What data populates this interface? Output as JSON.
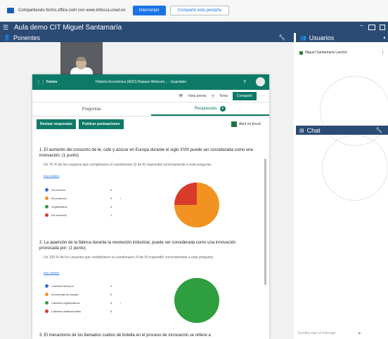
{
  "share_bar": {
    "text": "Compartiendo forms.office.com con www.infocca.uned.es",
    "stop_label": "Interrumpir",
    "share_label": "Compartir esta pestaña"
  },
  "app": {
    "title": "Aula demo CIT Miguel Santamaría"
  },
  "panels": {
    "ponentes": "Ponentes",
    "usuarios": "Usuarios",
    "chat": "Chat"
  },
  "users": [
    {
      "name": "Miguel Santamaría Lancho"
    }
  ],
  "chat_input_placeholder": "Escribe aquí el mensaje",
  "forms": {
    "brand": "Forms",
    "doc_title": "Historia Económica (ADO) Repaso Webcom... - Guardado",
    "toolbar": {
      "preview": "Vista previa",
      "theme": "Tema",
      "share": "Compartir",
      "more": "···"
    },
    "tabs": {
      "questions": "Preguntas",
      "responses": "Respuestas",
      "responses_count": "4"
    },
    "actions": {
      "review": "Revisar respuestas",
      "publish": "Publicar puntuaciones",
      "excel": "Abrir en Excel"
    },
    "questions": [
      {
        "title": "1. El aumento del consumo de té, café y azúcar en Europa durante el siglo XVIII puede ser considerada como una innovación: (1 punto)",
        "summary": "Un 75 % de los usuarios que completaron el cuestionario (3 de 4) respondió correctamente a esta pregunta.",
        "details": "Más detalles",
        "options": [
          {
            "label": "De proceso",
            "count": "0",
            "color": "#2e6fd1",
            "correct": false
          },
          {
            "label": "De producto",
            "count": "3",
            "color": "#f29321",
            "correct": true
          },
          {
            "label": "Organizativa",
            "count": "0",
            "color": "#2e9e3e",
            "correct": false
          },
          {
            "label": "De mercado",
            "count": "1",
            "color": "#d93b2b",
            "correct": false
          }
        ]
      },
      {
        "title": "2. La aparición de la fábrica durante la revolución industrial, puede ser considerada como una innovación provocada por: (1 punto)",
        "summary": "Un 100 % de los usuarios que completaron el cuestionario (4 de 4) respondió correctamente a esta pregunta.",
        "details": "Más detalles",
        "options": [
          {
            "label": "Cambios técnicos",
            "count": "0",
            "color": "#2e6fd1",
            "correct": false
          },
          {
            "label": "Economías de escala",
            "count": "0",
            "color": "#f29321",
            "correct": false
          },
          {
            "label": "Cambios organizativos",
            "count": "4",
            "color": "#2e9e3e",
            "correct": true
          },
          {
            "label": "Cambios institucionales",
            "count": "0",
            "color": "#d93b2b",
            "correct": false
          }
        ]
      },
      {
        "title": "3. El mecanismo de los llamados cuellos de botella en el proceso de innovación se refiere a"
      }
    ]
  }
}
